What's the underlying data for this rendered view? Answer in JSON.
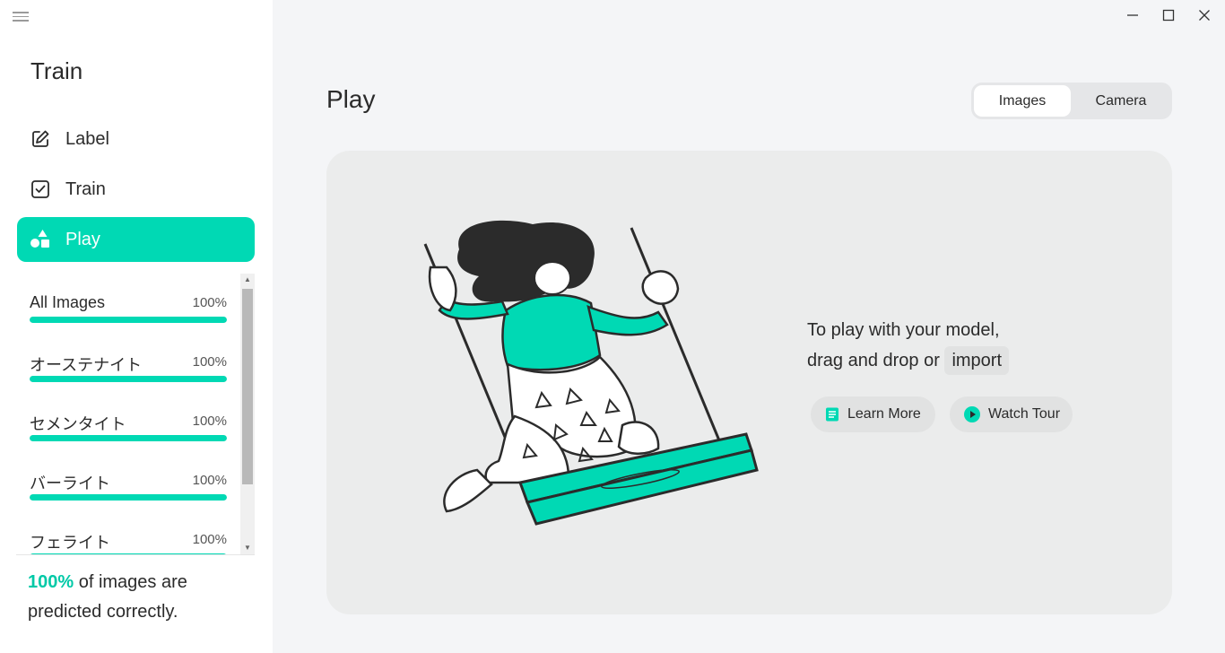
{
  "sidebar": {
    "title": "Train",
    "nav": [
      {
        "label": "Label",
        "icon": "pencil-square-icon"
      },
      {
        "label": "Train",
        "icon": "check-square-icon"
      },
      {
        "label": "Play",
        "icon": "shapes-icon",
        "active": true
      }
    ],
    "labels": [
      {
        "name": "All Images",
        "percent": "100%",
        "accuracy": 1.0
      },
      {
        "name": "オーステナイト",
        "percent": "100%",
        "accuracy": 1.0
      },
      {
        "name": "セメンタイト",
        "percent": "100%",
        "accuracy": 1.0
      },
      {
        "name": "バーライト",
        "percent": "100%",
        "accuracy": 1.0
      },
      {
        "name": "フェライト",
        "percent": "100%",
        "accuracy": 1.0
      }
    ],
    "summary": {
      "percent": "100%",
      "text": " of images are predicted correctly."
    }
  },
  "main": {
    "title": "Play",
    "tabs": [
      {
        "label": "Images",
        "selected": true
      },
      {
        "label": "Camera",
        "selected": false
      }
    ],
    "drop": {
      "line1": "To play with your model,",
      "line2": "drag and drop or ",
      "import_label": "import"
    },
    "learn_more": "Learn More",
    "watch_tour": "Watch Tour"
  },
  "colors": {
    "accent": "#00d9b4",
    "sidebar_bg": "#ffffff",
    "main_bg": "#f4f5f7",
    "card_bg": "#ebecec"
  }
}
